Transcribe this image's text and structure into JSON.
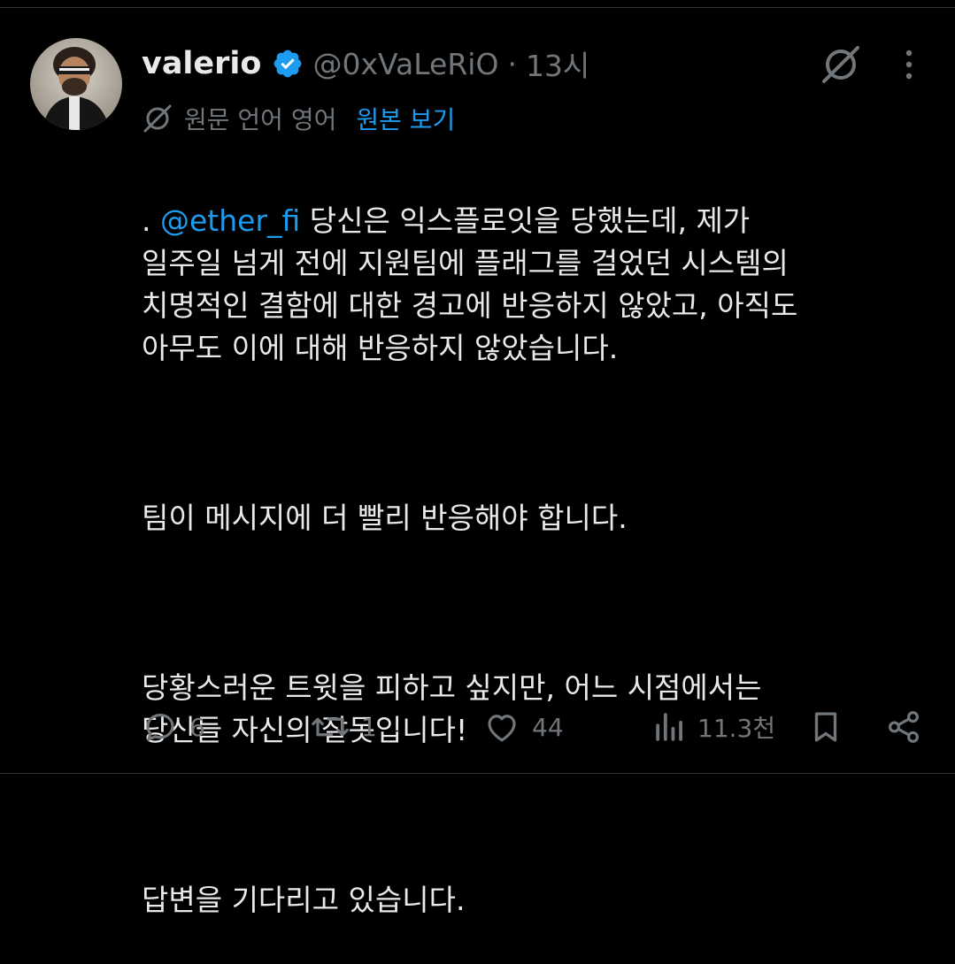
{
  "tweet": {
    "display_name": "valerio",
    "handle": "@0xVaLeRiO",
    "separator": "·",
    "time": "13시",
    "translation": {
      "label": "원문 언어 영어",
      "show_original": "원본 보기"
    },
    "body": {
      "para1_prefix": ". ",
      "mention": "@ether_fi",
      "para1_rest": " 당신은 익스플로잇을 당했는데, 제가\n일주일 넘게 전에 지원팀에 플래그를 걸었던 시스템의\n치명적인 결함에 대한 경고에 반응하지 않았고, 아직도\n아무도 이에 대해 반응하지 않았습니다.",
      "para2": "팀이 메시지에 더 빨리 반응해야 합니다.",
      "para3": "당황스러운 트윗을 피하고 싶지만, 어느 시점에서는\n당신들 자신의 잘못입니다!",
      "para4": "답변을 기다리고 있습니다."
    },
    "actions": {
      "replies": "6",
      "reposts": "1",
      "likes": "44",
      "views": "11.3천"
    }
  },
  "colors": {
    "background": "#000000",
    "text": "#e7e9ea",
    "muted": "#71767b",
    "accent": "#1d9bf0"
  },
  "icons": {
    "verified": "verified-badge-icon",
    "grok": "grok-icon",
    "more": "more-dots-icon",
    "translate": "translate-icon",
    "reply": "reply-icon",
    "repost": "repost-icon",
    "like": "heart-icon",
    "views": "views-icon",
    "bookmark": "bookmark-icon",
    "share": "share-icon"
  }
}
